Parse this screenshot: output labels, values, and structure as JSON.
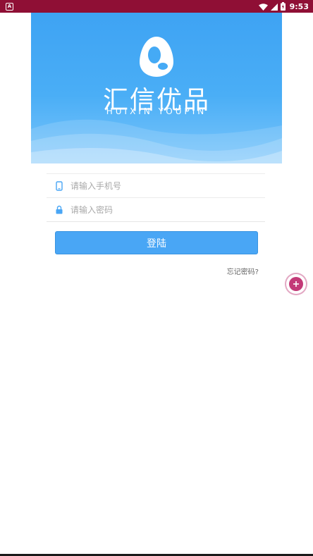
{
  "status_bar": {
    "app_badge": "A",
    "time": "9:53",
    "background": "#8f0f35"
  },
  "banner": {
    "brand_cn": "汇信优品",
    "brand_en": "HUIXIN YOUPIN",
    "gradient_top": "#3ea3f3",
    "gradient_bottom": "#7cc6fb"
  },
  "form": {
    "phone": {
      "icon": "phone-icon",
      "placeholder": "请输入手机号",
      "value": ""
    },
    "password": {
      "icon": "lock-icon",
      "placeholder": "请输入密码",
      "value": ""
    }
  },
  "login_button": {
    "label": "登陆",
    "color": "#49a6f5"
  },
  "forgot_link": {
    "label": "忘记密码?"
  },
  "float_button": {
    "icon": "plus-circle-icon",
    "color": "#c33a78"
  }
}
